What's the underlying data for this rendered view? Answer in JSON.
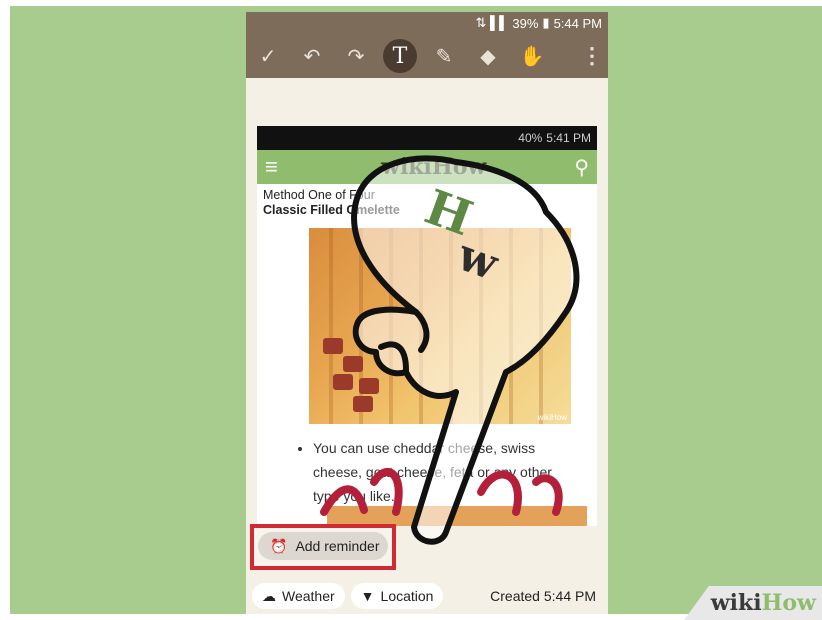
{
  "status_bar": {
    "signal": "⇅ ▌▌",
    "battery": "39%",
    "time": "5:44 PM"
  },
  "toolbar": {
    "icons": [
      "check-icon",
      "undo-icon",
      "redo-icon",
      "text-tool-icon",
      "pen-icon",
      "eraser-icon",
      "selection-icon",
      "overflow-menu-icon"
    ],
    "glyphs": {
      "check": "✓",
      "undo": "↶",
      "redo": "↷",
      "text": "T",
      "pen": "✎",
      "eraser": "◆",
      "select": "✋",
      "more": "⋮"
    }
  },
  "screenshot": {
    "status": {
      "battery": "40%",
      "time": "5:41 PM"
    },
    "header": {
      "menu_glyph": "≡",
      "logo": "wikiHow",
      "search_glyph": "⚲"
    },
    "method_title": "Method One of Four",
    "method_subtitle": "Classic Filled Omelette",
    "photo_watermark": "wikiHow",
    "bullet_text": "You can use cheddar cheese, swiss cheese, goat cheese, feta or any other type you like."
  },
  "reminder": {
    "icon_glyph": "⏰",
    "label": "Add reminder"
  },
  "bottom_bar": {
    "weather": {
      "icon_glyph": "☁",
      "label": "Weather"
    },
    "location": {
      "icon_glyph": "▼",
      "label": "Location"
    },
    "created": "Created 5:44 PM"
  },
  "watermark": {
    "part1": "wiki",
    "part2": "How"
  },
  "colors": {
    "stage_green": "#a8cc8e",
    "toolbar_brown": "#7d6c5a",
    "highlight_red": "#d22a33",
    "wikihow_green": "#8fbd6d"
  }
}
